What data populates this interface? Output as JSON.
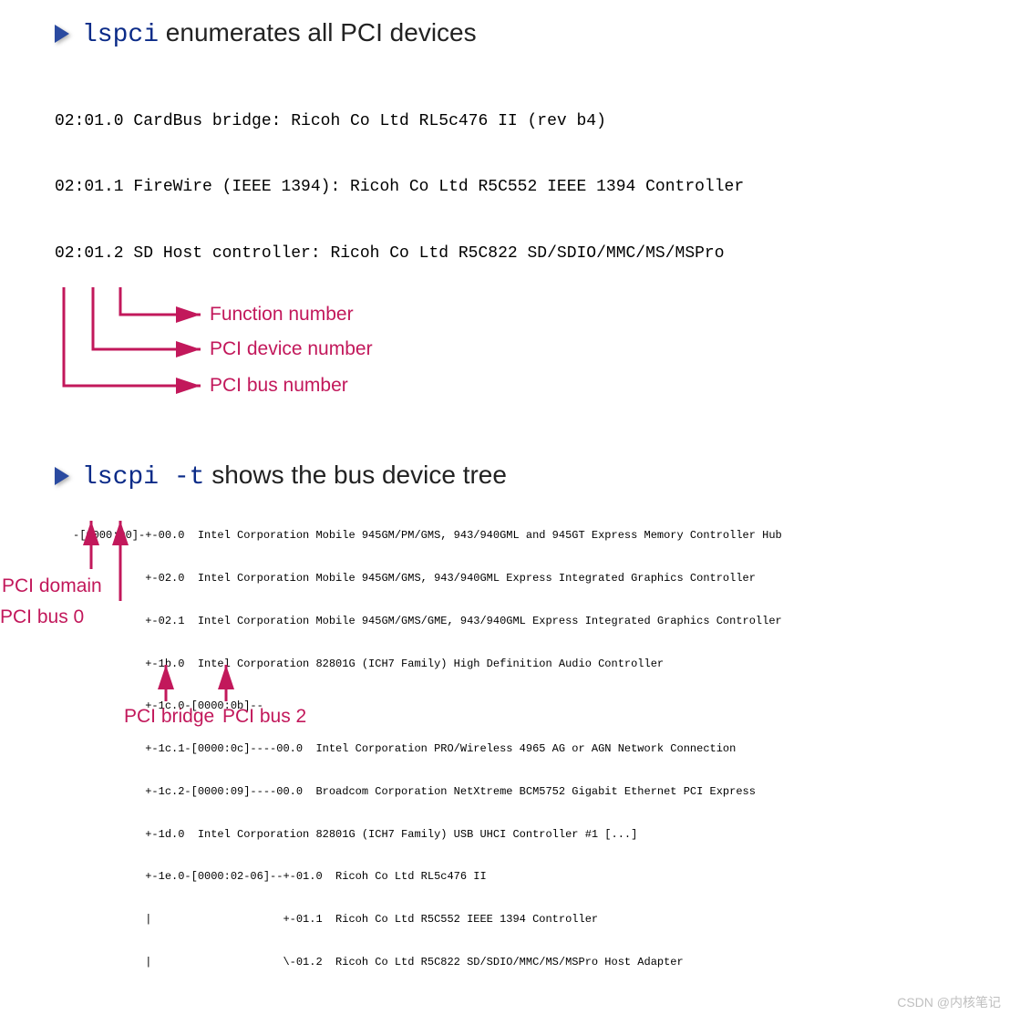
{
  "section1": {
    "command": "lspci",
    "heading_suffix": " enumerates all PCI devices",
    "lines": [
      "02:01.0 CardBus bridge: Ricoh Co Ltd RL5c476 II (rev b4)",
      "02:01.1 FireWire (IEEE 1394): Ricoh Co Ltd R5C552 IEEE 1394 Controller",
      "02:01.2 SD Host controller: Ricoh Co Ltd R5C822 SD/SDIO/MMC/MS/MSPro"
    ],
    "annotations": {
      "function_number": "Function number",
      "device_number": "PCI device number",
      "bus_number": "PCI bus number"
    }
  },
  "section2": {
    "command": "lscpi -t",
    "heading_suffix": " shows the bus device tree",
    "tree": [
      "-[0000:00]-+-00.0  Intel Corporation Mobile 945GM/PM/GMS, 943/940GML and 945GT Express Memory Controller Hub",
      "           +-02.0  Intel Corporation Mobile 945GM/GMS, 943/940GML Express Integrated Graphics Controller",
      "           +-02.1  Intel Corporation Mobile 945GM/GMS/GME, 943/940GML Express Integrated Graphics Controller",
      "           +-1b.0  Intel Corporation 82801G (ICH7 Family) High Definition Audio Controller",
      "           +-1c.0-[0000:0b]--",
      "           +-1c.1-[0000:0c]----00.0  Intel Corporation PRO/Wireless 4965 AG or AGN Network Connection",
      "           +-1c.2-[0000:09]----00.0  Broadcom Corporation NetXtreme BCM5752 Gigabit Ethernet PCI Express",
      "           +-1d.0  Intel Corporation 82801G (ICH7 Family) USB UHCI Controller #1 [...]",
      "           +-1e.0-[0000:02-06]--+-01.0  Ricoh Co Ltd RL5c476 II",
      "           |                    +-01.1  Ricoh Co Ltd R5C552 IEEE 1394 Controller",
      "           |                    \\-01.2  Ricoh Co Ltd R5C822 SD/SDIO/MMC/MS/MSPro Host Adapter"
    ],
    "annotations": {
      "pci_domain": "PCI domain",
      "pci_bus0": "PCI bus 0",
      "pci_bridge": "PCI bridge",
      "pci_bus2": "PCI bus 2"
    }
  },
  "watermark": "CSDN @内核笔记"
}
